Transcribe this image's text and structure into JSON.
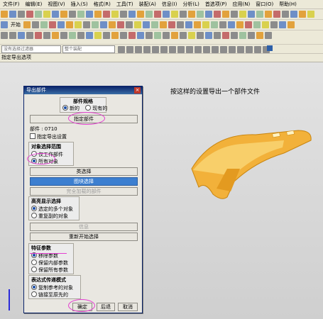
{
  "menubar": [
    "文件(F)",
    "编辑(E)",
    "视图(V)",
    "插入(S)",
    "格式(R)",
    "工具(T)",
    "装配(A)",
    "信息(I)",
    "分析(L)",
    "首选项(P)",
    "应用(N)",
    "窗口(O)",
    "帮助(H)"
  ],
  "toolbar": {
    "start_label": "开始"
  },
  "filter": {
    "type_filter": "没有选择过滤器",
    "scope": "整个装配"
  },
  "status_line": "指定导出选项",
  "note": "按这样的设置导出一个部件文件",
  "dialog": {
    "title": "导出部件",
    "part_spec": {
      "title": "部件规格",
      "options": [
        "新的",
        "现有的"
      ]
    },
    "specify_part_button": "指定部件",
    "part_label": "部件 : 0710",
    "specify_export_settings": "指定导出设置",
    "object_scope": {
      "title": "对象选择范围",
      "options": [
        "仅工作部件",
        "所有对象"
      ]
    },
    "class_select_button": "类选择",
    "layer_select_button": "图块选择",
    "all_loaded_button": "完全加载的部件",
    "highlight": {
      "title": "高亮显示选择",
      "options": [
        "选定的多个对象",
        "重复副的对象"
      ]
    },
    "info_button": "信息",
    "restart_button": "重新开始选择",
    "feature_params": {
      "title": "特征参数",
      "options": [
        "移除参数",
        "保留内部参数",
        "保留所有参数"
      ]
    },
    "expression_mode": {
      "title": "表达式传递模式",
      "options": [
        "复制参考的对象",
        "链接至原先的"
      ]
    },
    "ok_button": "确定",
    "back_button": "后退",
    "cancel_button": "取消"
  }
}
